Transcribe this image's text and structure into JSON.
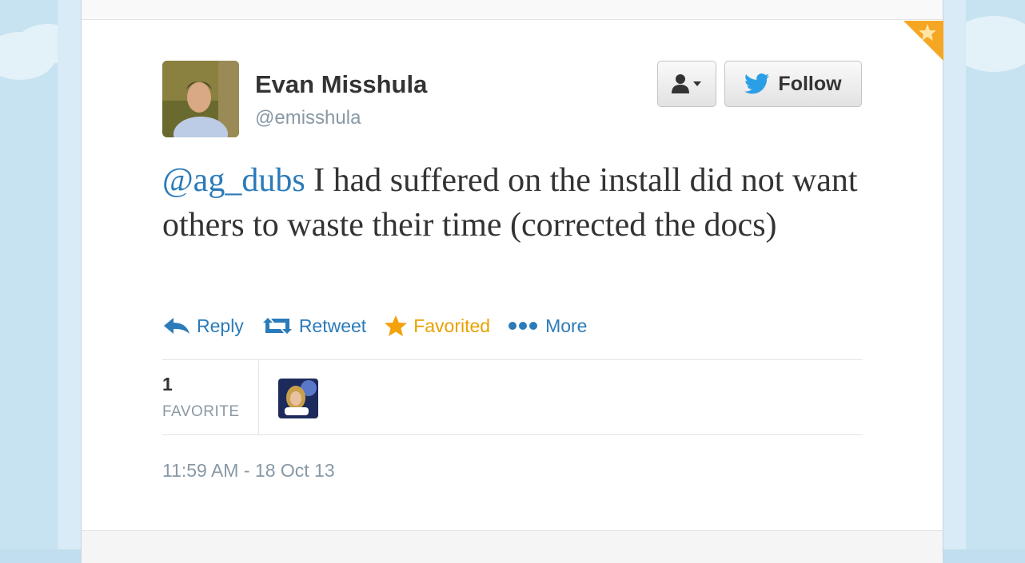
{
  "tweet": {
    "author": {
      "name": "Evan Misshula",
      "handle": "@emisshula"
    },
    "follow_label": "Follow",
    "mention": "@ag_dubs",
    "text": " I had suffered on the install did not want others to waste their time (corrected the docs)",
    "actions": {
      "reply": "Reply",
      "retweet": "Retweet",
      "favorited": "Favorited",
      "more": "More"
    },
    "stats": {
      "favorite_count": "1",
      "favorite_label": "FAVORITE"
    },
    "timestamp": "11:59 AM - 18 Oct 13"
  },
  "colors": {
    "link": "#2b7bb9",
    "favorited": "#e8a100",
    "muted": "#8899a6",
    "text": "#333333",
    "background": "#c0deed"
  },
  "icons": {
    "reply": "reply-arrow-icon",
    "retweet": "retweet-icon",
    "favorite": "star-icon",
    "more": "ellipsis-icon",
    "follow": "twitter-bird-icon",
    "user_menu": "user-dropdown-icon"
  }
}
